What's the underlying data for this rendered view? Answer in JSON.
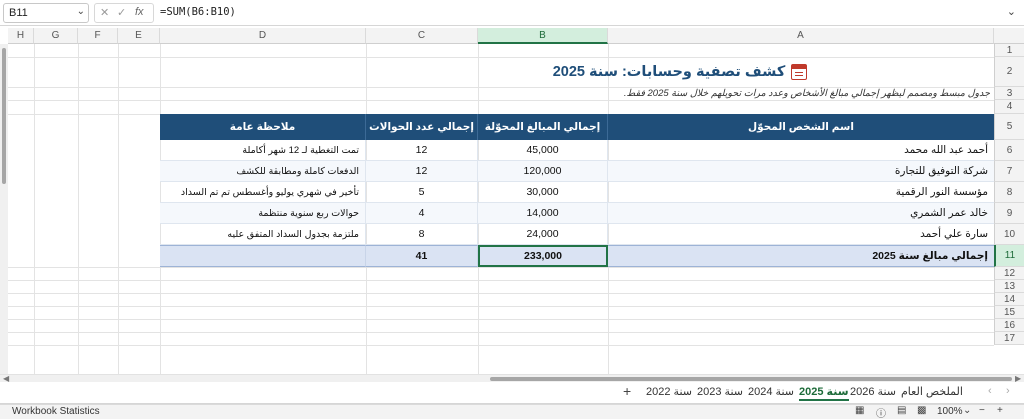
{
  "formula_bar": {
    "name_box": "B11",
    "formula": "=SUM(B6:B10)"
  },
  "columns": [
    {
      "id": "H",
      "label": "H"
    },
    {
      "id": "G",
      "label": "G"
    },
    {
      "id": "F",
      "label": "F"
    },
    {
      "id": "E",
      "label": "E"
    },
    {
      "id": "D",
      "label": "D"
    },
    {
      "id": "C",
      "label": "C"
    },
    {
      "id": "B",
      "label": "B"
    },
    {
      "id": "A",
      "label": "A"
    }
  ],
  "rows": [
    "1",
    "2",
    "3",
    "4",
    "5",
    "6",
    "7",
    "8",
    "9",
    "10",
    "11",
    "12",
    "13",
    "14",
    "15",
    "16",
    "17"
  ],
  "sheet": {
    "title": "كشف تصفية وحسابات: سنة 2025",
    "title_icon": "calendar-icon",
    "subtitle": "جدول مبسط ومصمم ليظهر إجمالي مبالغ الأشخاص وعدد مرات تحويلهم خلال سنة 2025 فقط.",
    "headers": {
      "name": "اسم الشخص المحوّل",
      "total": "إجمالي المبالغ المحوّلة",
      "count": "إجمالي عدد الحوالات",
      "note": "ملاحظة عامة"
    },
    "records": [
      {
        "name": "أحمد عبد الله محمد",
        "total": "45,000",
        "count": "12",
        "note": "تمت التغطية لـ 12 شهر أكاملة"
      },
      {
        "name": "شركة التوفيق للتجارة",
        "total": "120,000",
        "count": "12",
        "note": "الدفعات كاملة ومطابقة للكشف"
      },
      {
        "name": "مؤسسة النور الرقمية",
        "total": "30,000",
        "count": "5",
        "note": "تأخير في شهري يوليو وأغسطس تم تم السداد"
      },
      {
        "name": "خالد عمر الشمري",
        "total": "14,000",
        "count": "4",
        "note": "حوالات ربع سنوية منتظمة"
      },
      {
        "name": "سارة علي أحمد",
        "total": "24,000",
        "count": "8",
        "note": "ملتزمة بجدول السداد المتفق عليه"
      }
    ],
    "totals": {
      "label": "إجمالي مبالغ سنة 2025",
      "total": "233,000",
      "count": "41"
    },
    "colors": {
      "header_bg": "#1f4e79",
      "total_bg": "#dae3f3",
      "accent": "#217346"
    }
  },
  "tabs": [
    {
      "label": "الملخص العام",
      "active": false
    },
    {
      "label": "سنة 2026",
      "active": false
    },
    {
      "label": "سنة 2025",
      "active": true
    },
    {
      "label": "سنة 2024",
      "active": false
    },
    {
      "label": "سنة 2023",
      "active": false
    },
    {
      "label": "سنة 2022",
      "active": false
    }
  ],
  "status": {
    "workbook_stats": "Workbook Statistics",
    "zoom": "100%"
  }
}
